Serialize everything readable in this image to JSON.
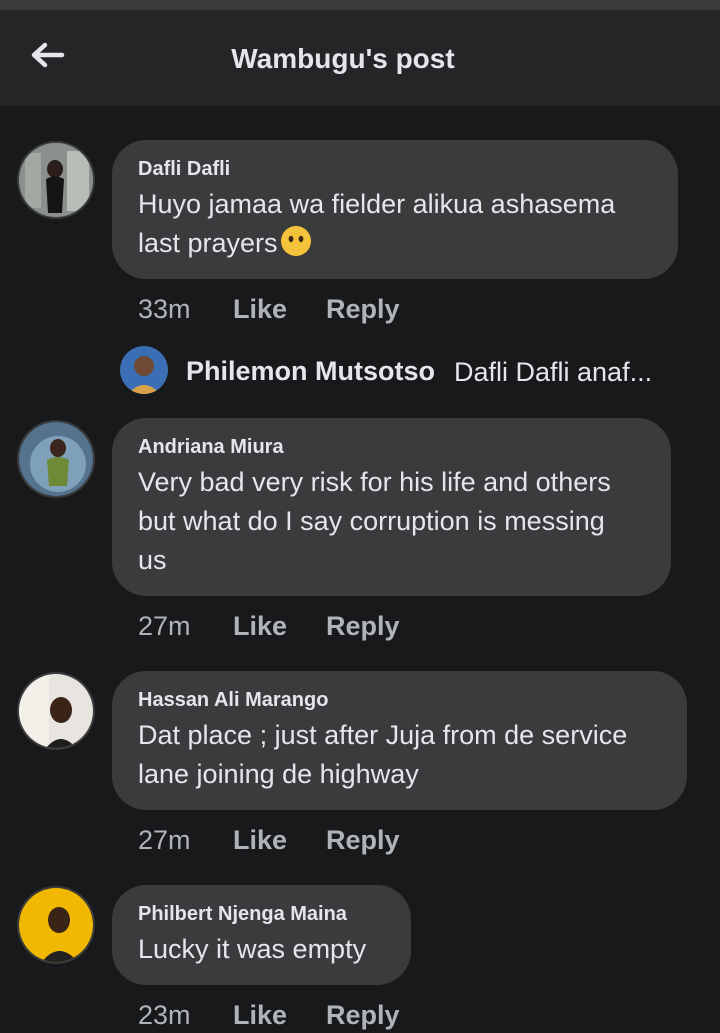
{
  "header": {
    "title": "Wambugu's post",
    "back_icon": "arrow-left-icon"
  },
  "comments": [
    {
      "author": "Dafli Dafli",
      "text_lines": [
        "Huyo jamaa wa fielder alikua ashasema",
        "last prayers"
      ],
      "emoji": "no-mouth-face-emoji",
      "time": "33m",
      "like": "Like",
      "reply": "Reply"
    },
    {
      "author": "Andriana Miura",
      "text_lines": [
        "Very bad very risk for his life and others",
        "but what do I say corruption is messing",
        "us"
      ],
      "time": "27m",
      "like": "Like",
      "reply": "Reply"
    },
    {
      "author": "Hassan Ali Marango",
      "text_lines": [
        "Dat place ; just after Juja from de service",
        "lane joining de highway"
      ],
      "time": "27m",
      "like": "Like",
      "reply": "Reply"
    },
    {
      "author": "Philbert Njenga Maina",
      "text_lines": [
        "Lucky it was empty"
      ],
      "time": "23m",
      "like": "Like",
      "reply": "Reply"
    }
  ],
  "reply_preview": {
    "author": "Philemon Mutsotso",
    "text": "Dafli Dafli anaf..."
  },
  "colors": {
    "background": "#18191a",
    "bubble": "#3a3b3c",
    "secondary_text": "#b0b3b8",
    "primary_text": "#e4e6eb"
  }
}
